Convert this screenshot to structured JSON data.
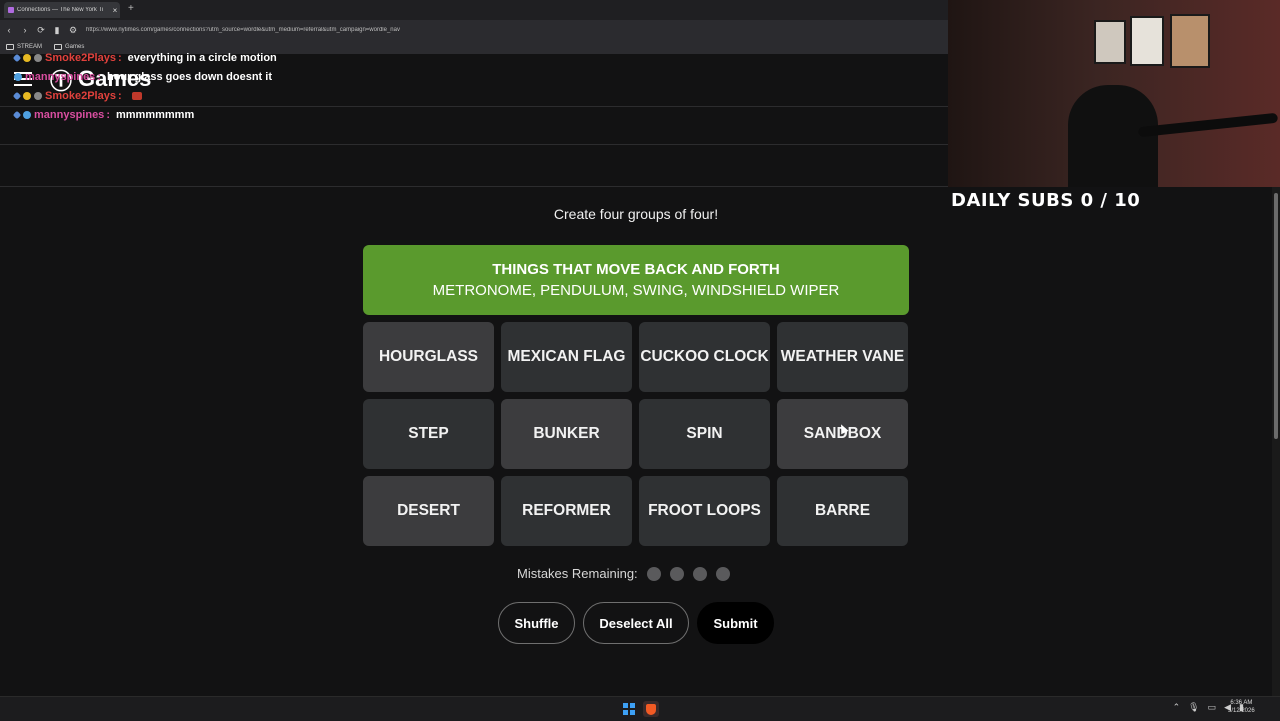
{
  "browser": {
    "tab_title": "Connections — The New York Ti",
    "tab_close": "×",
    "new_tab": "+",
    "url": "https://www.nytimes.com/games/connections?utm_source=wordle&utm_medium=referral&utm_campaign=wordle_nav",
    "bookmarks": [
      "STREAM",
      "Games"
    ]
  },
  "header": {
    "logo": "Ⓣ",
    "title": "Games"
  },
  "chat": [
    {
      "user": "Smoke2Plays",
      "user_color": "#e0413c",
      "message": "everything in a circle motion"
    },
    {
      "user": "mannyspines",
      "user_color": "#d94ea0",
      "message": "hour glass goes down doesnt it"
    },
    {
      "user": "Smoke2Plays",
      "user_color": "#e0413c",
      "message": ""
    },
    {
      "user": "mannyspines",
      "user_color": "#d94ea0",
      "message": "mmmmmmmm"
    }
  ],
  "overlay": {
    "subs": "DAILY SUBS 0 / 10"
  },
  "game": {
    "prompt": "Create four groups of four!",
    "solved": [
      {
        "category": "THINGS THAT MOVE BACK AND FORTH",
        "members": "METRONOME, PENDULUM, SWING, WINDSHIELD WIPER",
        "color": "#5a9a2d"
      }
    ],
    "tiles": [
      "HOURGLASS",
      "MEXICAN FLAG",
      "CUCKOO CLOCK",
      "WEATHER VANE",
      "STEP",
      "BUNKER",
      "SPIN",
      "SANDBOX",
      "DESERT",
      "REFORMER",
      "FROOT LOOPS",
      "BARRE"
    ],
    "mistakes_label": "Mistakes Remaining:",
    "mistakes_remaining": 4,
    "buttons": {
      "shuffle": "Shuffle",
      "deselect": "Deselect All",
      "submit": "Submit"
    }
  },
  "taskbar": {
    "time": "6:36 AM",
    "date": "3/12/2026"
  }
}
